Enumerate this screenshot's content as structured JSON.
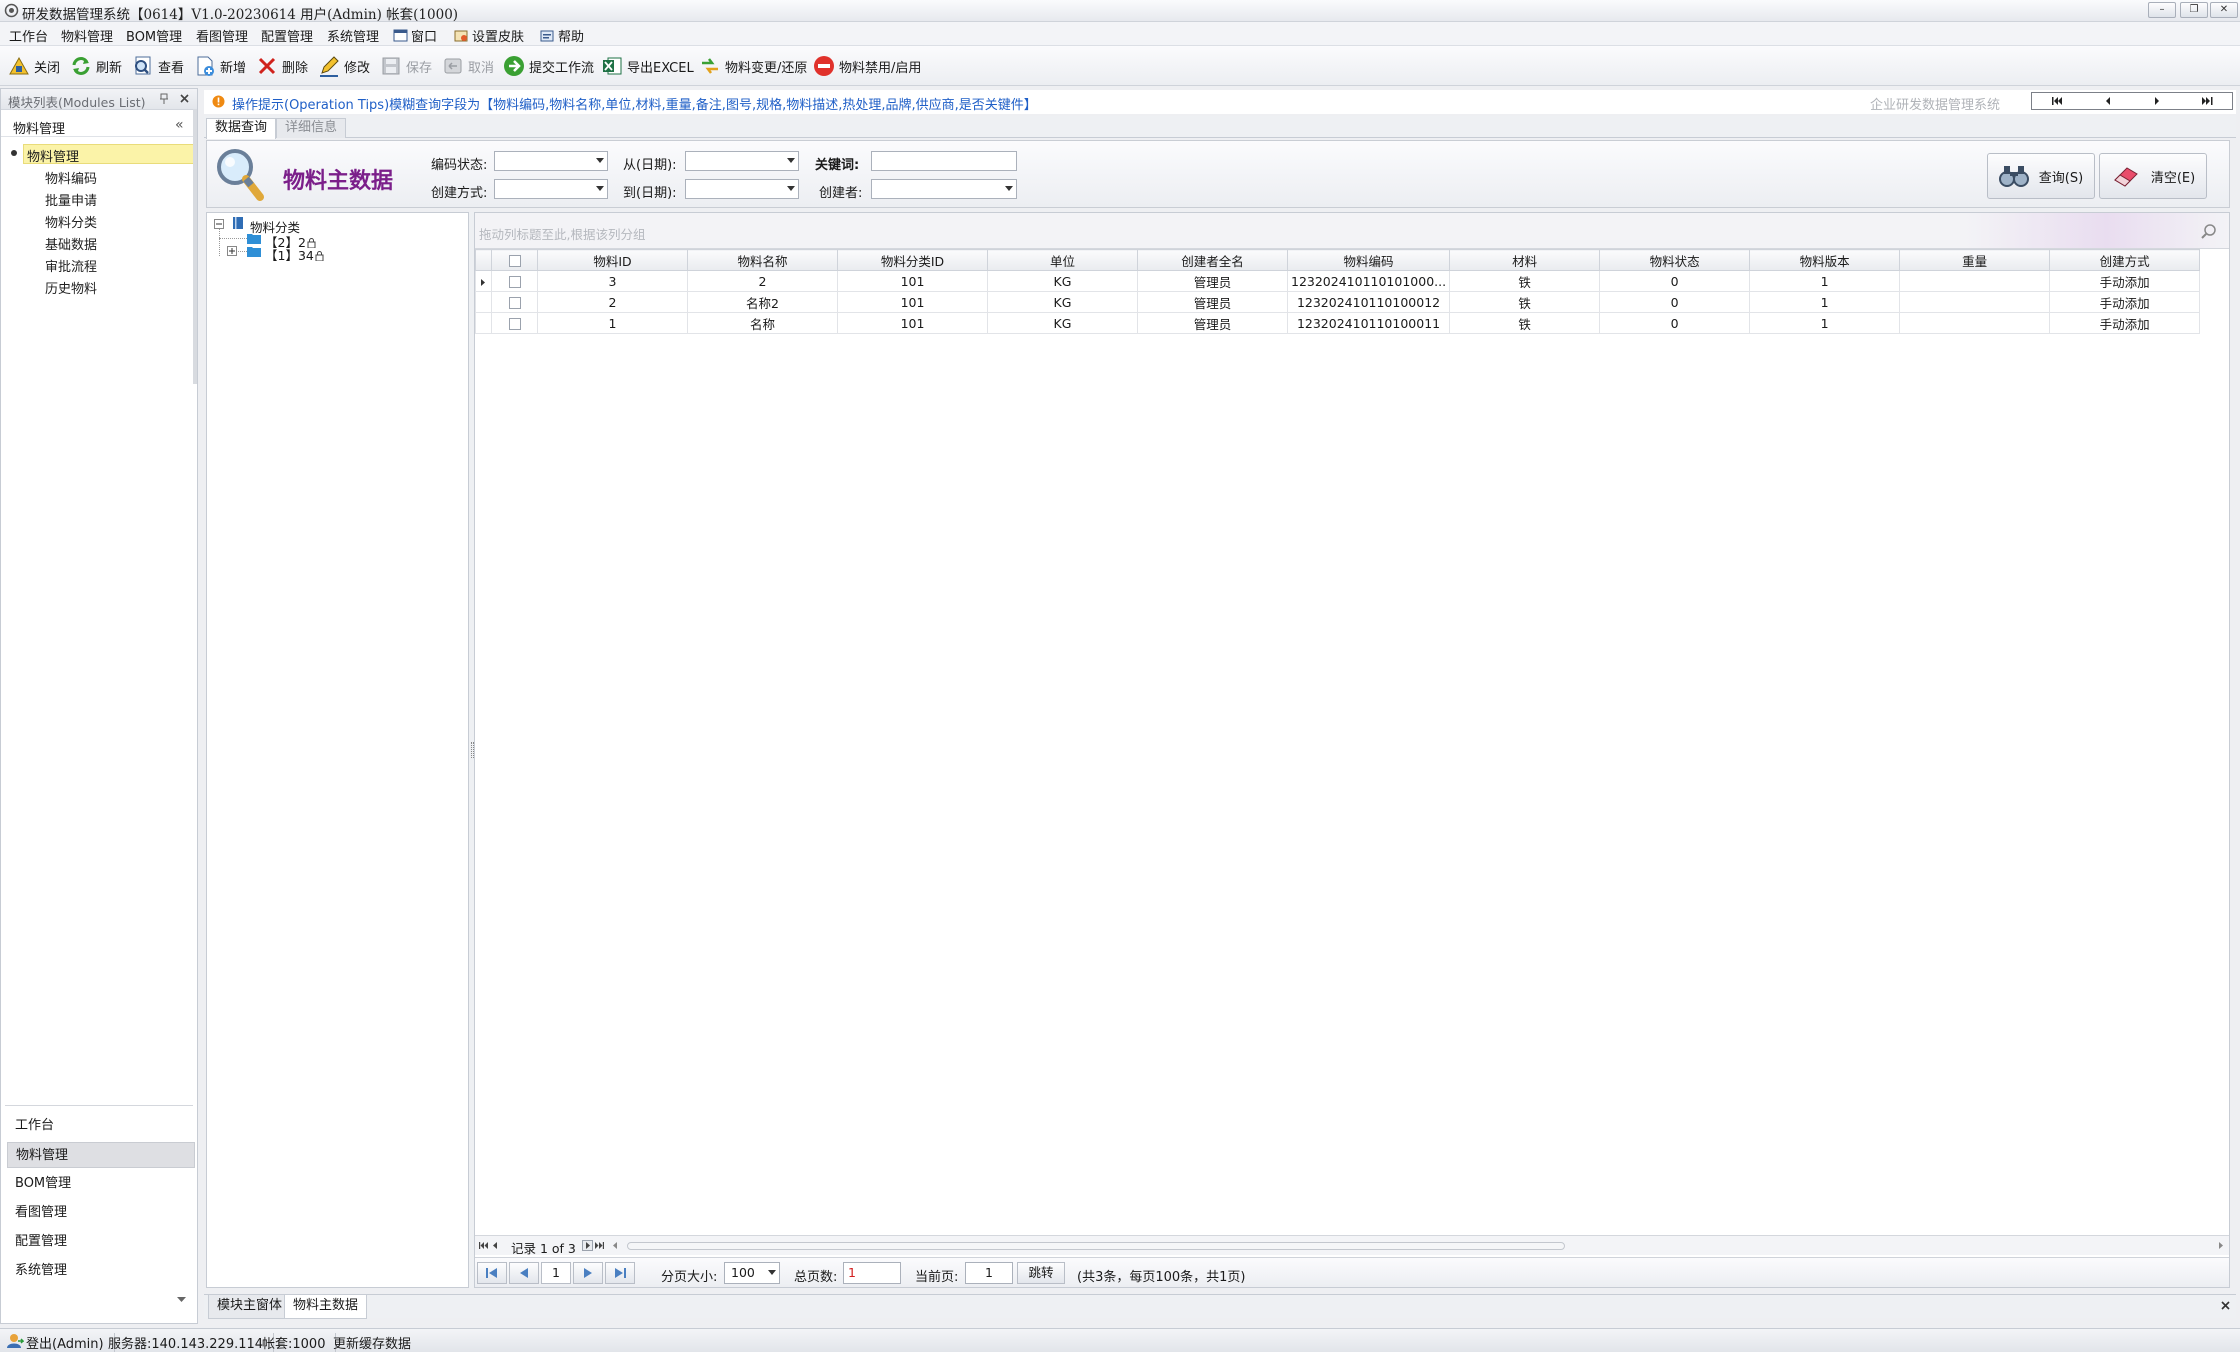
{
  "window": {
    "title": "研发数据管理系统【0614】V1.0-20230614 用户(Admin) 帐套(1000)",
    "controls": [
      "–",
      "❐",
      "✕"
    ]
  },
  "menu": [
    "工作台",
    "物料管理",
    "BOM管理",
    "看图管理",
    "配置管理",
    "系统管理",
    "窗口",
    "设置皮肤",
    "帮助"
  ],
  "toolbar": {
    "close": "关闭",
    "refresh": "刷新",
    "view": "查看",
    "new": "新增",
    "delete": "删除",
    "edit": "修改",
    "save": "保存",
    "cancel": "取消",
    "submit_workflow": "提交工作流",
    "export_excel": "导出EXCEL",
    "change_restore": "物料变更/还原",
    "disable_enable": "物料禁用/启用"
  },
  "left_panel": {
    "header": "模块列表(Modules List)",
    "group_title": "物料管理",
    "collapse_glyph": "«",
    "selected_item": "物料管理",
    "items": [
      "物料编码",
      "批量申请",
      "物料分类",
      "基础数据",
      "审批流程",
      "历史物料"
    ],
    "bottom_nav": [
      "工作台",
      "物料管理",
      "BOM管理",
      "看图管理",
      "配置管理",
      "系统管理"
    ]
  },
  "tip": {
    "text": "操作提示(Operation Tips)模糊查询字段为【物料编码,物料名称,单位,材料,重量,备注,图号,规格,物料描述,热处理,品牌,供应商,是否关键件】",
    "company": "企业研发数据管理系统"
  },
  "tabs": [
    "数据查询",
    "详细信息"
  ],
  "search": {
    "title": "物料主数据",
    "code_status_label": "编码状态:",
    "from_date_label": "从(日期):",
    "keyword_label": "关键词:",
    "create_method_label": "创建方式:",
    "to_date_label": "到(日期):",
    "creator_label": "创建者:",
    "query_button": "查询(S)",
    "clear_button": "清空(E)"
  },
  "tree": {
    "root": "物料分类",
    "nodes": [
      "【2】2",
      "【1】34"
    ]
  },
  "grid": {
    "group_hint": "拖动列标题至此,根据该列分组",
    "columns": [
      "物料ID",
      "物料名称",
      "物料分类ID",
      "单位",
      "创建者全名",
      "物料编码",
      "材料",
      "物料状态",
      "物料版本",
      "重量",
      "创建方式"
    ],
    "rows": [
      [
        "3",
        "2",
        "101",
        "KG",
        "管理员",
        "123202410110101000...",
        "铁",
        "0",
        "1",
        "",
        "手动添加"
      ],
      [
        "2",
        "名称2",
        "101",
        "KG",
        "管理员",
        "123202410110100012",
        "铁",
        "0",
        "1",
        "",
        "手动添加"
      ],
      [
        "1",
        "名称",
        "101",
        "KG",
        "管理员",
        "123202410110100011",
        "铁",
        "0",
        "1",
        "",
        "手动添加"
      ]
    ],
    "record_nav": "记录 1 of 3"
  },
  "pager": {
    "page_input": "1",
    "page_size_label": "分页大小:",
    "page_size": "100",
    "total_pages_label": "总页数:",
    "total_pages": "1",
    "current_page_label": "当前页:",
    "current_page": "1",
    "jump_button": "跳转",
    "summary": "(共3条，每页100条，共1页)"
  },
  "bottom_tabs": [
    "模块主窗体",
    "物料主数据"
  ],
  "status": {
    "logout": "登出(Admin)",
    "server": "服务器:140.143.229.114",
    "account": "帐套:1000",
    "cache": "更新缓存数据"
  },
  "colors": {
    "title_purple": "#7b1f8a",
    "tip_blue": "#1f5fc7",
    "selected_yellow": "#fbf3a8",
    "red_value": "#d21f1f"
  }
}
